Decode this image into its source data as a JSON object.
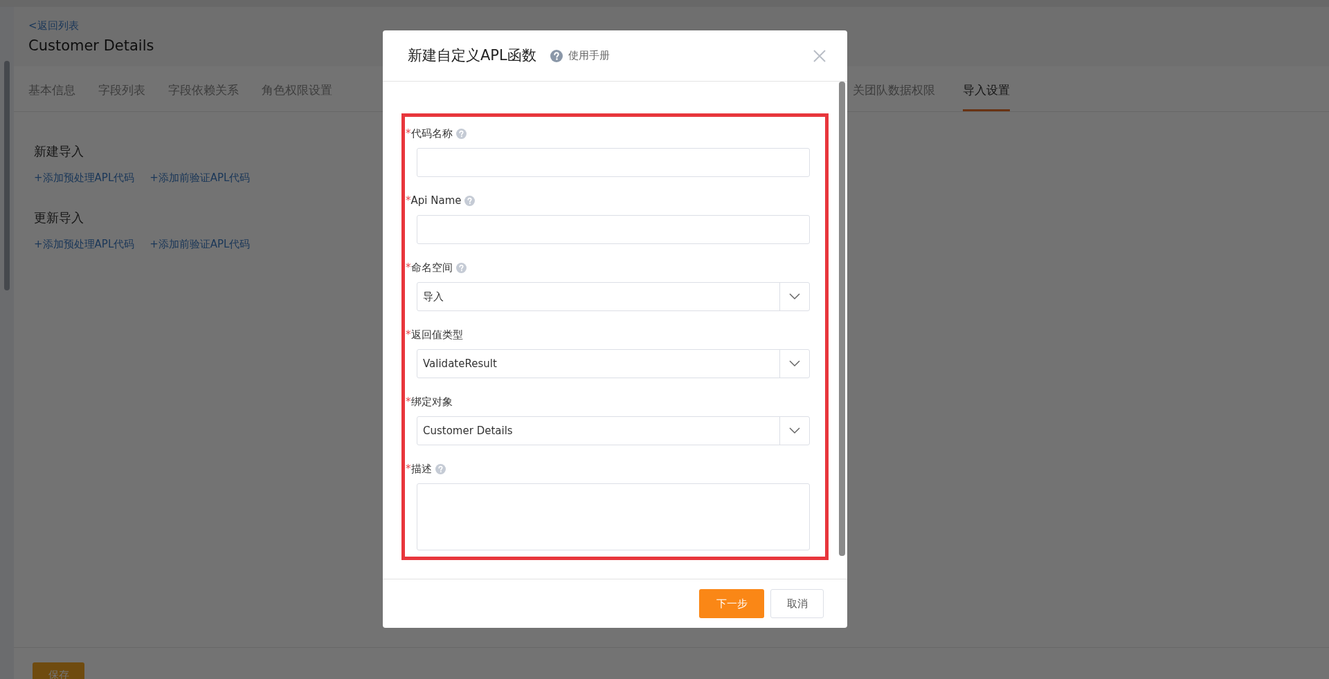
{
  "page": {
    "back_link": "<返回列表",
    "title": "Customer Details",
    "tabs_left": [
      {
        "label": "基本信息",
        "selected": false
      },
      {
        "label": "字段列表",
        "selected": false
      },
      {
        "label": "字段依赖关系",
        "selected": false
      },
      {
        "label": "角色权限设置",
        "selected": false
      }
    ],
    "tabs_right": [
      {
        "label": "关团队数据权限",
        "selected": false
      },
      {
        "label": "导入设置",
        "selected": true
      }
    ],
    "sections": [
      {
        "title": "新建导入",
        "links": [
          "+添加预处理APL代码",
          "+添加前验证APL代码"
        ]
      },
      {
        "title": "更新导入",
        "links": [
          "+添加预处理APL代码",
          "+添加前验证APL代码"
        ]
      }
    ],
    "save_button": "保存"
  },
  "dialog": {
    "title": "新建自定义APL函数",
    "help_link": "使用手册",
    "fields": [
      {
        "label": "代码名称",
        "required_mark": "*",
        "help": true,
        "kind": "text"
      },
      {
        "label": "Api Name",
        "required_mark": "*",
        "help": true,
        "kind": "text"
      },
      {
        "label": "命名空间",
        "required_mark": "*",
        "help": true,
        "kind": "select",
        "value": "导入"
      },
      {
        "label": "返回值类型",
        "required_mark": "*",
        "help": false,
        "kind": "select",
        "value": "ValidateResult"
      },
      {
        "label": "绑定对象",
        "required_mark": "*",
        "help": false,
        "kind": "select",
        "value": "Customer Details"
      },
      {
        "label": "描述",
        "required_mark": "*",
        "help": true,
        "kind": "textarea"
      }
    ],
    "buttons": [
      {
        "label": "下一步",
        "kind": "primary"
      },
      {
        "label": "取消",
        "kind": "secondary"
      }
    ]
  }
}
